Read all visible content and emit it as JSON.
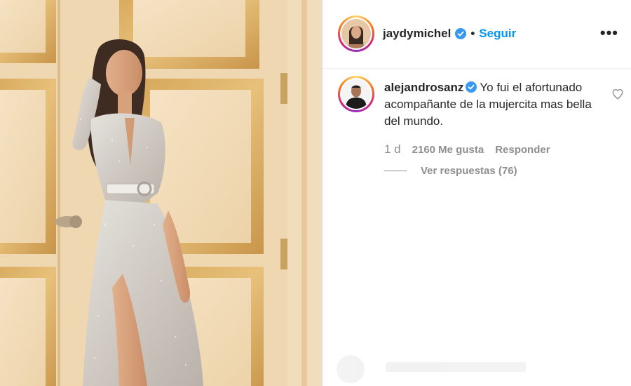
{
  "post": {
    "author": "jaydymichel",
    "separator": "•",
    "follow_label": "Seguir",
    "more_label": "•••"
  },
  "comment": {
    "author": "alejandrosanz",
    "text": "Yo fui el afortunado acompañante de la mujercita mas bella del mundo.",
    "time": "1 d",
    "likes": "2160 Me gusta",
    "reply_label": "Responder",
    "view_replies": "Ver respuestas (76)"
  },
  "icons": {
    "verified": "verified-badge-icon",
    "heart": "heart-outline-icon",
    "more": "more-options-icon"
  },
  "colors": {
    "accent": "#0095f6",
    "text": "#262626",
    "muted": "#8e8e8e",
    "door": "#e8c99c"
  }
}
